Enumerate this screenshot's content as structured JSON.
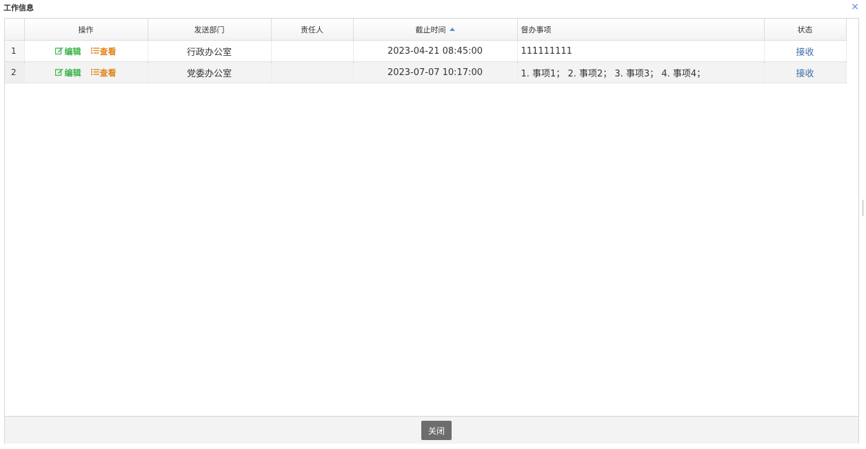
{
  "window": {
    "title": "工作信息",
    "close_symbol": "×"
  },
  "table": {
    "headers": {
      "ops": "操作",
      "dept": "发送部门",
      "owner": "责任人",
      "deadline": "截止时间",
      "items": "督办事项",
      "status": "状态"
    },
    "sort_column": "deadline",
    "rows": [
      {
        "num": "1",
        "edit": "编辑",
        "view": "查看",
        "dept": "行政办公室",
        "owner": "",
        "deadline": "2023-04-21 08:45:00",
        "items": "111111111",
        "status": "接收"
      },
      {
        "num": "2",
        "edit": "编辑",
        "view": "查看",
        "dept": "党委办公室",
        "owner": "",
        "deadline": "2023-07-07 10:17:00",
        "items": "1. 事项1； 2. 事项2； 3. 事项3； 4. 事项4；",
        "status": "接收"
      }
    ]
  },
  "footer": {
    "close_label": "关闭"
  },
  "colors": {
    "edit": "#3cb34a",
    "view": "#e0861d",
    "link": "#3a6aa8",
    "button": "#6d6d6d"
  },
  "icons": {
    "edit": "edit-icon",
    "view": "list-icon",
    "sort": "sort-asc-icon",
    "close": "close-icon"
  }
}
